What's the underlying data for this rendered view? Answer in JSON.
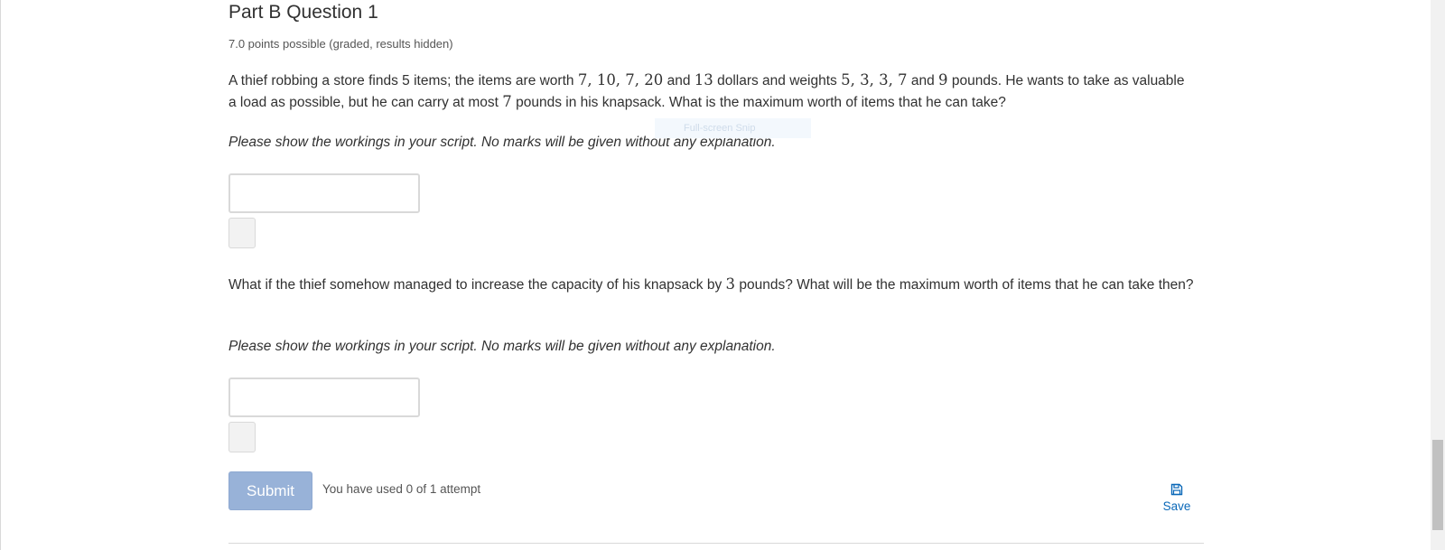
{
  "question": {
    "title": "Part B Question 1",
    "points": "7.0 points possible (graded, results hidden)"
  },
  "part1": {
    "text_a": "A thief robbing a store finds 5 items; the items are worth ",
    "worths": "7, 10, 7, 20",
    "text_b": " and ",
    "worth_last": "13",
    "text_c": " dollars and weights ",
    "weights": "5, 3, 3, 7",
    "text_d": " and ",
    "weight_last": "9",
    "text_e": " pounds. He wants to take as valuable a load as possible, but he can carry at most ",
    "capacity": "7",
    "text_f": " pounds in his knapsack. What is the maximum worth of items that he can take?",
    "instruction": "Please show the workings in your script. No marks will be given without any explanation."
  },
  "part2": {
    "text_a": "What if the thief somehow managed to increase the capacity of his knapsack by ",
    "increase": "3",
    "text_b": " pounds? What will be the maximum worth of items that he can take then?",
    "instruction": "Please show the workings in your script. No marks will be given without any explanation."
  },
  "overlay": {
    "snip_hint": "Full-screen Snip"
  },
  "actions": {
    "submit_label": "Submit",
    "attempts_text": "You have used 0 of 1 attempt",
    "save_label": "Save",
    "save_icon": "floppy-disk-icon"
  },
  "colors": {
    "submit_bg": "#98b2d8",
    "link": "#0a68b8",
    "text": "#313131"
  }
}
